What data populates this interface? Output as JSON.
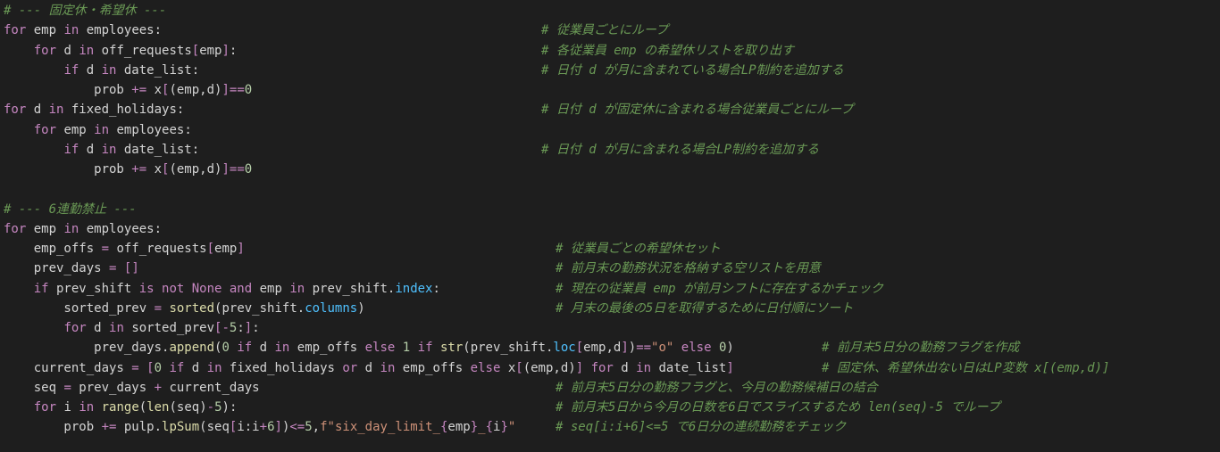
{
  "lines": [
    {
      "comment": "# --- 固定休・希望休 ---"
    },
    {
      "code": [
        [
          "kw",
          "for"
        ],
        [
          "plain",
          " emp "
        ],
        [
          "kw",
          "in"
        ],
        [
          "plain",
          " employees:"
        ]
      ],
      "comment": "# 従業員ごとにループ"
    },
    {
      "code": [
        [
          "plain",
          "    "
        ],
        [
          "kw",
          "for"
        ],
        [
          "plain",
          " d "
        ],
        [
          "kw",
          "in"
        ],
        [
          "plain",
          " off_requests"
        ],
        [
          "br",
          "["
        ],
        [
          "plain",
          "emp"
        ],
        [
          "br",
          "]"
        ],
        [
          "plain",
          ":"
        ]
      ],
      "comment": "# 各従業員 emp の希望休リストを取り出す"
    },
    {
      "code": [
        [
          "plain",
          "        "
        ],
        [
          "kw",
          "if"
        ],
        [
          "plain",
          " d "
        ],
        [
          "kw",
          "in"
        ],
        [
          "plain",
          " date_list:"
        ]
      ],
      "comment": "# 日付 d が月に含まれている場合LP制約を追加する"
    },
    {
      "code": [
        [
          "plain",
          "            prob "
        ],
        [
          "op",
          "+="
        ],
        [
          "plain",
          " x"
        ],
        [
          "br",
          "["
        ],
        [
          "plain",
          "(emp,d)"
        ],
        [
          "br",
          "]"
        ],
        [
          "op",
          "=="
        ],
        [
          "num",
          "0"
        ]
      ]
    },
    {
      "code": [
        [
          "kw",
          "for"
        ],
        [
          "plain",
          " d "
        ],
        [
          "kw",
          "in"
        ],
        [
          "plain",
          " fixed_holidays:"
        ]
      ],
      "comment": "# 日付 d が固定休に含まれる場合従業員ごとにループ"
    },
    {
      "code": [
        [
          "plain",
          "    "
        ],
        [
          "kw",
          "for"
        ],
        [
          "plain",
          " emp "
        ],
        [
          "kw",
          "in"
        ],
        [
          "plain",
          " employees:"
        ]
      ]
    },
    {
      "code": [
        [
          "plain",
          "        "
        ],
        [
          "kw",
          "if"
        ],
        [
          "plain",
          " d "
        ],
        [
          "kw",
          "in"
        ],
        [
          "plain",
          " date_list:"
        ]
      ],
      "comment": "# 日付 d が月に含まれる場合LP制約を追加する"
    },
    {
      "code": [
        [
          "plain",
          "            prob "
        ],
        [
          "op",
          "+="
        ],
        [
          "plain",
          " x"
        ],
        [
          "br",
          "["
        ],
        [
          "plain",
          "(emp,d)"
        ],
        [
          "br",
          "]"
        ],
        [
          "op",
          "=="
        ],
        [
          "num",
          "0"
        ]
      ]
    },
    {},
    {
      "comment": "# --- 6連勤禁止 ---"
    },
    {
      "code": [
        [
          "kw",
          "for"
        ],
        [
          "plain",
          " emp "
        ],
        [
          "kw",
          "in"
        ],
        [
          "plain",
          " employees:"
        ]
      ]
    },
    {
      "code": [
        [
          "plain",
          "    emp_offs "
        ],
        [
          "op",
          "="
        ],
        [
          "plain",
          " off_requests"
        ],
        [
          "br",
          "["
        ],
        [
          "plain",
          "emp"
        ],
        [
          "br",
          "]"
        ]
      ],
      "comment": "# 従業員ごとの希望休セット"
    },
    {
      "code": [
        [
          "plain",
          "    prev_days "
        ],
        [
          "op",
          "="
        ],
        [
          "plain",
          " "
        ],
        [
          "br",
          "[]"
        ]
      ],
      "comment": "# 前月末の勤務状況を格納する空リストを用意"
    },
    {
      "code": [
        [
          "plain",
          "    "
        ],
        [
          "kw",
          "if"
        ],
        [
          "plain",
          " prev_shift "
        ],
        [
          "kw",
          "is not None and"
        ],
        [
          "plain",
          " emp "
        ],
        [
          "kw",
          "in"
        ],
        [
          "plain",
          " prev_shift."
        ],
        [
          "attr",
          "index"
        ],
        [
          "plain",
          ":"
        ]
      ],
      "comment": "# 現在の従業員 emp が前月シフトに存在するかチェック"
    },
    {
      "code": [
        [
          "plain",
          "        sorted_prev "
        ],
        [
          "op",
          "="
        ],
        [
          "plain",
          " "
        ],
        [
          "fn",
          "sorted"
        ],
        [
          "plain",
          "(prev_shift."
        ],
        [
          "attr",
          "columns"
        ],
        [
          "plain",
          ")"
        ]
      ],
      "comment": "# 月末の最後の5日を取得するために日付順にソート"
    },
    {
      "code": [
        [
          "plain",
          "        "
        ],
        [
          "kw",
          "for"
        ],
        [
          "plain",
          " d "
        ],
        [
          "kw",
          "in"
        ],
        [
          "plain",
          " sorted_prev"
        ],
        [
          "br",
          "["
        ],
        [
          "op",
          "-"
        ],
        [
          "num",
          "5"
        ],
        [
          "plain",
          ":"
        ],
        [
          "br",
          "]"
        ],
        [
          "plain",
          ":"
        ]
      ]
    },
    {
      "code": [
        [
          "plain",
          "            prev_days."
        ],
        [
          "fn",
          "append"
        ],
        [
          "plain",
          "("
        ],
        [
          "num",
          "0"
        ],
        [
          "plain",
          " "
        ],
        [
          "kw",
          "if"
        ],
        [
          "plain",
          " d "
        ],
        [
          "kw",
          "in"
        ],
        [
          "plain",
          " emp_offs "
        ],
        [
          "kw",
          "else"
        ],
        [
          "plain",
          " "
        ],
        [
          "num",
          "1"
        ],
        [
          "plain",
          " "
        ],
        [
          "kw",
          "if"
        ],
        [
          "plain",
          " "
        ],
        [
          "fn",
          "str"
        ],
        [
          "plain",
          "(prev_shift."
        ],
        [
          "attr",
          "loc"
        ],
        [
          "br",
          "["
        ],
        [
          "plain",
          "emp,d"
        ],
        [
          "br",
          "]"
        ],
        [
          "plain",
          ")"
        ],
        [
          "op",
          "=="
        ],
        [
          "str",
          "\"o\""
        ],
        [
          "plain",
          " "
        ],
        [
          "kw",
          "else"
        ],
        [
          "plain",
          " "
        ],
        [
          "num",
          "0"
        ],
        [
          "plain",
          ")"
        ]
      ],
      "comment": "# 前月末5日分の勤務フラグを作成"
    },
    {
      "code": [
        [
          "plain",
          "    current_days "
        ],
        [
          "op",
          "="
        ],
        [
          "plain",
          " "
        ],
        [
          "br",
          "["
        ],
        [
          "num",
          "0"
        ],
        [
          "plain",
          " "
        ],
        [
          "kw",
          "if"
        ],
        [
          "plain",
          " d "
        ],
        [
          "kw",
          "in"
        ],
        [
          "plain",
          " fixed_holidays "
        ],
        [
          "kw",
          "or"
        ],
        [
          "plain",
          " d "
        ],
        [
          "kw",
          "in"
        ],
        [
          "plain",
          " emp_offs "
        ],
        [
          "kw",
          "else"
        ],
        [
          "plain",
          " x"
        ],
        [
          "br",
          "["
        ],
        [
          "plain",
          "(emp,d)"
        ],
        [
          "br",
          "]"
        ],
        [
          "plain",
          " "
        ],
        [
          "kw",
          "for"
        ],
        [
          "plain",
          " d "
        ],
        [
          "kw",
          "in"
        ],
        [
          "plain",
          " date_list"
        ],
        [
          "br",
          "]"
        ]
      ],
      "comment": "# 固定休、希望休出ない日はLP変数 x[(emp,d)]"
    },
    {
      "code": [
        [
          "plain",
          "    seq "
        ],
        [
          "op",
          "="
        ],
        [
          "plain",
          " prev_days "
        ],
        [
          "op",
          "+"
        ],
        [
          "plain",
          " current_days"
        ]
      ],
      "comment": "# 前月末5日分の勤務フラグと、今月の勤務候補日の結合"
    },
    {
      "code": [
        [
          "plain",
          "    "
        ],
        [
          "kw",
          "for"
        ],
        [
          "plain",
          " i "
        ],
        [
          "kw",
          "in"
        ],
        [
          "plain",
          " "
        ],
        [
          "fn",
          "range"
        ],
        [
          "plain",
          "("
        ],
        [
          "fn",
          "len"
        ],
        [
          "plain",
          "(seq)"
        ],
        [
          "op",
          "-"
        ],
        [
          "num",
          "5"
        ],
        [
          "plain",
          "):"
        ]
      ],
      "comment": "# 前月末5日から今月の日数を6日でスライスするため len(seq)-5 でループ"
    },
    {
      "code": [
        [
          "plain",
          "        prob "
        ],
        [
          "op",
          "+="
        ],
        [
          "plain",
          " pulp."
        ],
        [
          "fn",
          "lpSum"
        ],
        [
          "plain",
          "(seq"
        ],
        [
          "br",
          "["
        ],
        [
          "plain",
          "i:i"
        ],
        [
          "op",
          "+"
        ],
        [
          "num",
          "6"
        ],
        [
          "br",
          "]"
        ],
        [
          "plain",
          ")"
        ],
        [
          "op",
          "<="
        ],
        [
          "num",
          "5"
        ],
        [
          "plain",
          ","
        ],
        [
          "str",
          "f\"six_day_limit_"
        ],
        [
          "br",
          "{"
        ],
        [
          "plain",
          "emp"
        ],
        [
          "br",
          "}"
        ],
        [
          "str",
          "_"
        ],
        [
          "br",
          "{"
        ],
        [
          "plain",
          "i"
        ],
        [
          "br",
          "}"
        ],
        [
          "str",
          "\""
        ]
      ],
      "comment": "# seq[i:i+6]<=5 で6日分の連続勤務をチェック"
    }
  ],
  "colors": {
    "background": "#1e1e1e",
    "keyword": "#c586c0",
    "comment": "#6a9955",
    "number": "#b5cea8",
    "string": "#ce9178",
    "function": "#dcdcaa",
    "attribute": "#4fc1ff",
    "text": "#d4d4d4"
  }
}
